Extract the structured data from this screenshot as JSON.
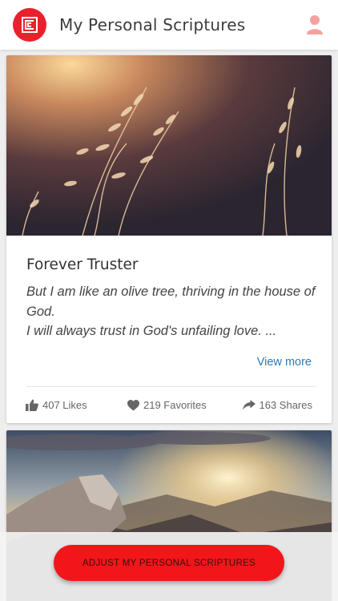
{
  "app": {
    "title": "My Personal Scriptures"
  },
  "cards": [
    {
      "title": "Forever Truster",
      "text_line1": "But I am like an olive tree, thriving in the house of God.",
      "text_line2": "I will always trust in God's unfailing love. ...",
      "view_more": "View more",
      "likes": "407 Likes",
      "favorites": "219 Favorites",
      "shares": "163 Shares"
    }
  ],
  "actions": {
    "adjust_label": "ADJUST MY PERSONAL SCRIPTURES"
  },
  "colors": {
    "brand_red": "#e8222d",
    "button_red": "#f2161a",
    "link_blue": "#2a7ab8"
  }
}
